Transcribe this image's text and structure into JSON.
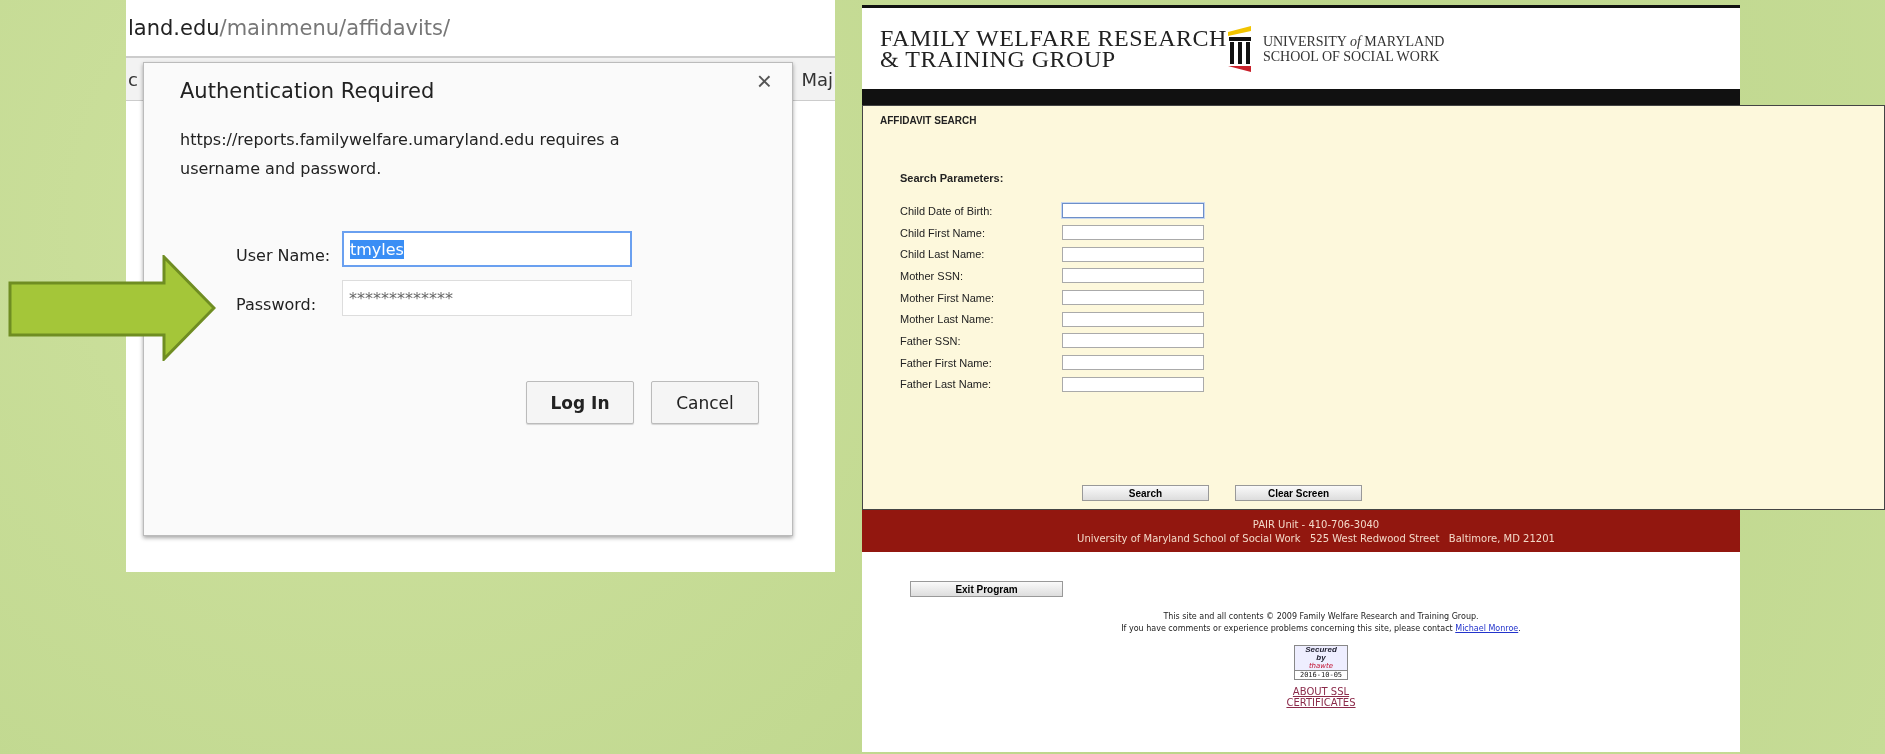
{
  "browser": {
    "address": {
      "host": "land.edu",
      "path": "/mainmenu/affidavits/"
    },
    "tab_strip": [
      "c",
      "Maj"
    ]
  },
  "auth_dialog": {
    "title": "Authentication Required",
    "message": "https://reports.familywelfare.umaryland.edu requires a username and password.",
    "close": "×",
    "fields": [
      {
        "label": "User Name:",
        "value": "tmyles",
        "focused": true,
        "text_selected": true
      },
      {
        "label": "Password:",
        "value": "*************",
        "focused": false,
        "text_selected": false
      }
    ],
    "buttons": [
      {
        "label": "Log In",
        "default": true
      },
      {
        "label": "Cancel",
        "default": false
      }
    ]
  },
  "site": {
    "header": {
      "org_lines": [
        "FAMILY WELFARE RESEARCH",
        "& TRAINING GROUP"
      ],
      "university_lines": [
        "UNIVERSITY *of* MARYLAND",
        "SCHOOL OF SOCIAL WORK"
      ]
    },
    "page_title": "AFFIDAVIT SEARCH",
    "section": "Search Parameters:",
    "fields": [
      {
        "label": "Child Date of Birth:",
        "focused": true
      },
      {
        "label": "Child First Name:",
        "focused": false
      },
      {
        "label": "Child Last Name:",
        "focused": false
      },
      {
        "label": "Mother SSN:",
        "focused": false
      },
      {
        "label": "Mother First Name:",
        "focused": false
      },
      {
        "label": "Mother Last Name:",
        "focused": false
      },
      {
        "label": "Father SSN:",
        "focused": false
      },
      {
        "label": "Father First Name:",
        "focused": false
      },
      {
        "label": "Father Last Name:",
        "focused": false
      }
    ],
    "buttons": [
      "Search",
      "Clear Screen"
    ],
    "footer_lines": [
      "PAIR Unit - 410-706-3040",
      "University of Maryland School of Social Work   525 West Redwood Street   Baltimore, MD 21201"
    ],
    "exit_button": "Exit Program",
    "copyright": "This site and all contents © 2009 Family Welfare Research and Training Group.",
    "contact": {
      "text": "If you have comments or experience problems concerning this site, please contact",
      "link": "Michael Monroe",
      "end": "."
    },
    "seal": {
      "lines": [
        "Secured",
        "by"
      ],
      "brand": "thawte",
      "date": "2016-10-05"
    },
    "ssl_link": "ABOUT SSL CERTIFICATES"
  }
}
